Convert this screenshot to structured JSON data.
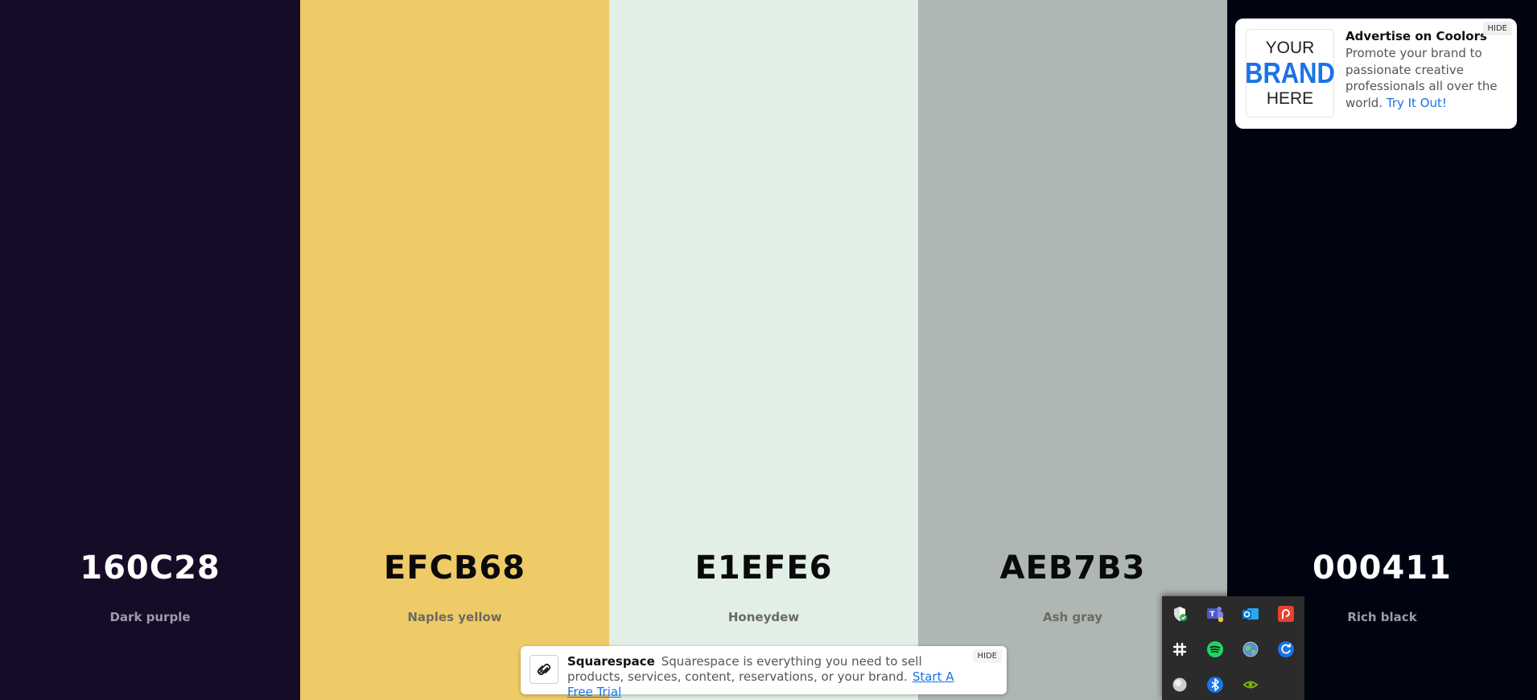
{
  "palette": [
    {
      "hex": "160C28",
      "name": "Dark purple",
      "color": "#160C28",
      "tone": "dark"
    },
    {
      "hex": "EFCB68",
      "name": "Naples yellow",
      "color": "#EFCB68",
      "tone": "light"
    },
    {
      "hex": "E1EFE6",
      "name": "Honeydew",
      "color": "#E1EFE6",
      "tone": "light"
    },
    {
      "hex": "AEB7B3",
      "name": "Ash gray",
      "color": "#AEB7B3",
      "tone": "light"
    },
    {
      "hex": "000411",
      "name": "Rich black",
      "color": "#000411",
      "tone": "dark"
    }
  ],
  "ad": {
    "logo_line1": "YOUR",
    "logo_line2": "BRAND",
    "logo_line3": "HERE",
    "title": "Advertise on Coolors",
    "description": "Promote your brand to passionate creative professionals all over the world.",
    "cta": "Try It Out!",
    "hide_label": "HIDE"
  },
  "banner": {
    "brand": "Squarespace",
    "description": "Squarespace is everything you need to sell products, services, content, reservations, or your brand.",
    "cta": "Start A Free Trial",
    "hide_label": "HIDE"
  },
  "tray": {
    "icons": [
      "windows-security-icon",
      "teams-icon",
      "outlook-icon",
      "pocketcasts-icon",
      "slack-icon",
      "spotify-icon",
      "network-globe-icon",
      "sync-app-icon",
      "round-app-icon",
      "bluetooth-icon",
      "nvidia-icon"
    ]
  }
}
